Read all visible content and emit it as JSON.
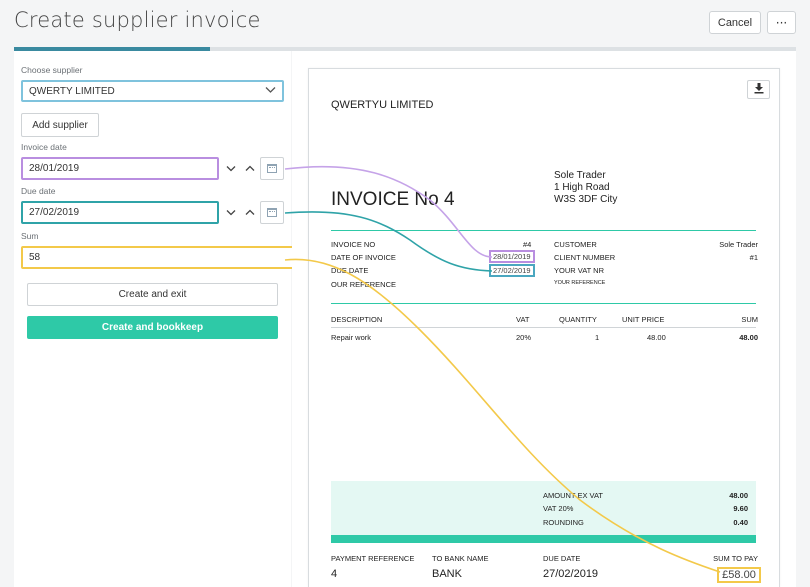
{
  "header": {
    "title": "Create supplier invoice",
    "cancel_label": "Cancel",
    "more_label": "···"
  },
  "progress": {
    "fraction": 0.25
  },
  "form": {
    "supplier_label": "Choose supplier",
    "supplier_value": "QWERTY LIMITED",
    "add_supplier_label": "Add supplier",
    "invoice_date_label": "Invoice date",
    "invoice_date_value": "28/01/2019",
    "due_date_label": "Due date",
    "due_date_value": "27/02/2019",
    "sum_label": "Sum",
    "sum_value": "58",
    "create_exit_label": "Create and exit",
    "create_bookkeep_label": "Create and bookkeep"
  },
  "invoice": {
    "company": "QWERTYU LIMITED",
    "trader_lines": [
      "Sole Trader",
      "1 High Road",
      "W3S 3DF City"
    ],
    "title": "INVOICE No 4",
    "left_meta": [
      {
        "label": "INVOICE NO",
        "value": "#4"
      },
      {
        "label": "DATE OF INVOICE",
        "value": "28/01/2019"
      },
      {
        "label": "DUE DATE",
        "value": "27/02/2019"
      },
      {
        "label": "OUR REFERENCE",
        "value": ""
      }
    ],
    "right_meta": [
      {
        "label": "CUSTOMER",
        "value": "Sole Trader"
      },
      {
        "label": "CLIENT NUMBER",
        "value": "#1"
      },
      {
        "label": "YOUR VAT NR",
        "value": ""
      },
      {
        "label": "YOUR REFERENCE",
        "value": ""
      }
    ],
    "table_headers": [
      "DESCRIPTION",
      "VAT",
      "QUANTITY",
      "UNIT PRICE",
      "SUM"
    ],
    "table_rows": [
      [
        "Repair work",
        "20%",
        "1",
        "48.00",
        "48.00"
      ]
    ],
    "totals": [
      {
        "label": "AMOUNT EX VAT",
        "value": "48.00"
      },
      {
        "label": "VAT 20%",
        "value": "9.60"
      },
      {
        "label": "ROUNDING",
        "value": "0.40"
      }
    ],
    "footer": [
      {
        "label": "PAYMENT REFERENCE",
        "value": "4"
      },
      {
        "label": "TO BANK NAME",
        "value": "BANK"
      },
      {
        "label": "DUE DATE",
        "value": "27/02/2019"
      },
      {
        "label": "SUM TO PAY",
        "value": "£58.00"
      }
    ]
  },
  "colors": {
    "invoice_date_highlight": "#b98ee0",
    "due_date_highlight": "#2fa3a8",
    "sum_highlight": "#f3c94a",
    "accent_teal": "#2ec9a7",
    "progress": "#3a8aa0"
  },
  "icons": [
    "chevron-down-icon",
    "chevron-up-icon",
    "calendar-icon",
    "download-icon"
  ]
}
